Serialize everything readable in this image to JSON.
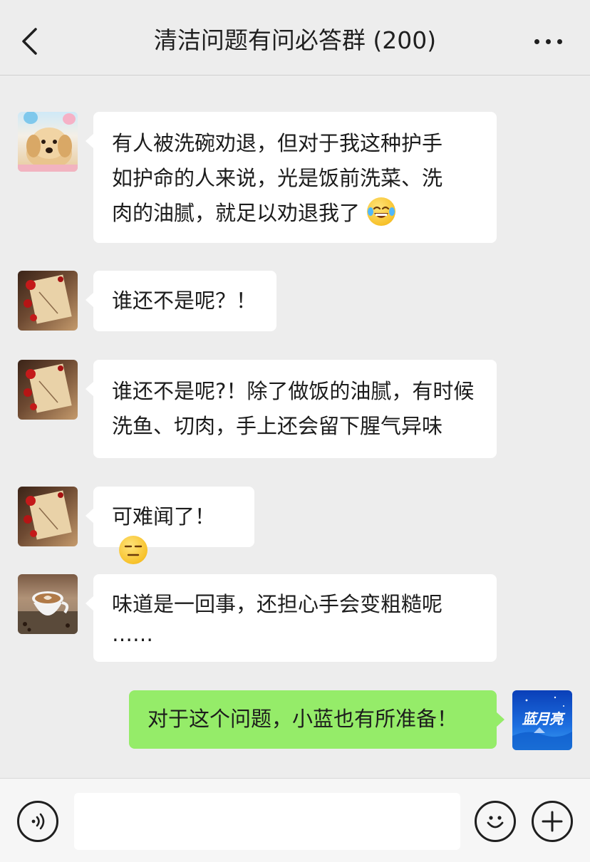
{
  "header": {
    "title": "清洁问题有问必答群 (200)",
    "back_icon": "chevron-left-icon",
    "more_icon": "more-horizontal-icon"
  },
  "messages": [
    {
      "sender": "other",
      "avatar": "dog-avatar",
      "lines": [
        "有人被洗碗劝退，但对于我这种护手",
        "如护命的人来说，光是饭前洗菜、洗",
        "肉的油腻，就足以劝退我了"
      ],
      "emoji": "face-with-tears-of-joy-emoji"
    },
    {
      "sender": "other",
      "avatar": "rose-scroll-avatar",
      "lines": [
        "谁还不是呢？！"
      ]
    },
    {
      "sender": "other",
      "avatar": "rose-scroll-avatar",
      "lines": [
        "谁还不是呢?！除了做饭的油腻，有时候",
        "洗鱼、切肉，手上还会留下腥气异味"
      ]
    },
    {
      "sender": "other",
      "avatar": "rose-scroll-avatar",
      "lines": [
        "可难闻了！"
      ],
      "emoji": "expressionless-face-emoji"
    },
    {
      "sender": "other",
      "avatar": "coffee-cup-avatar",
      "lines": [
        "味道是一回事，还担心手会变粗糙呢",
        "……"
      ]
    },
    {
      "sender": "self",
      "avatar": "lanyueliang-logo-avatar",
      "avatar_text": "蓝月亮",
      "lines": [
        "对于这个问题，小蓝也有所准备！"
      ]
    }
  ],
  "input_bar": {
    "voice_icon": "voice-icon",
    "input_value": "",
    "emoji_icon": "smiley-icon",
    "plus_icon": "plus-icon"
  },
  "colors": {
    "background": "#ededed",
    "self_bubble": "#95ec69",
    "other_bubble": "#ffffff"
  }
}
